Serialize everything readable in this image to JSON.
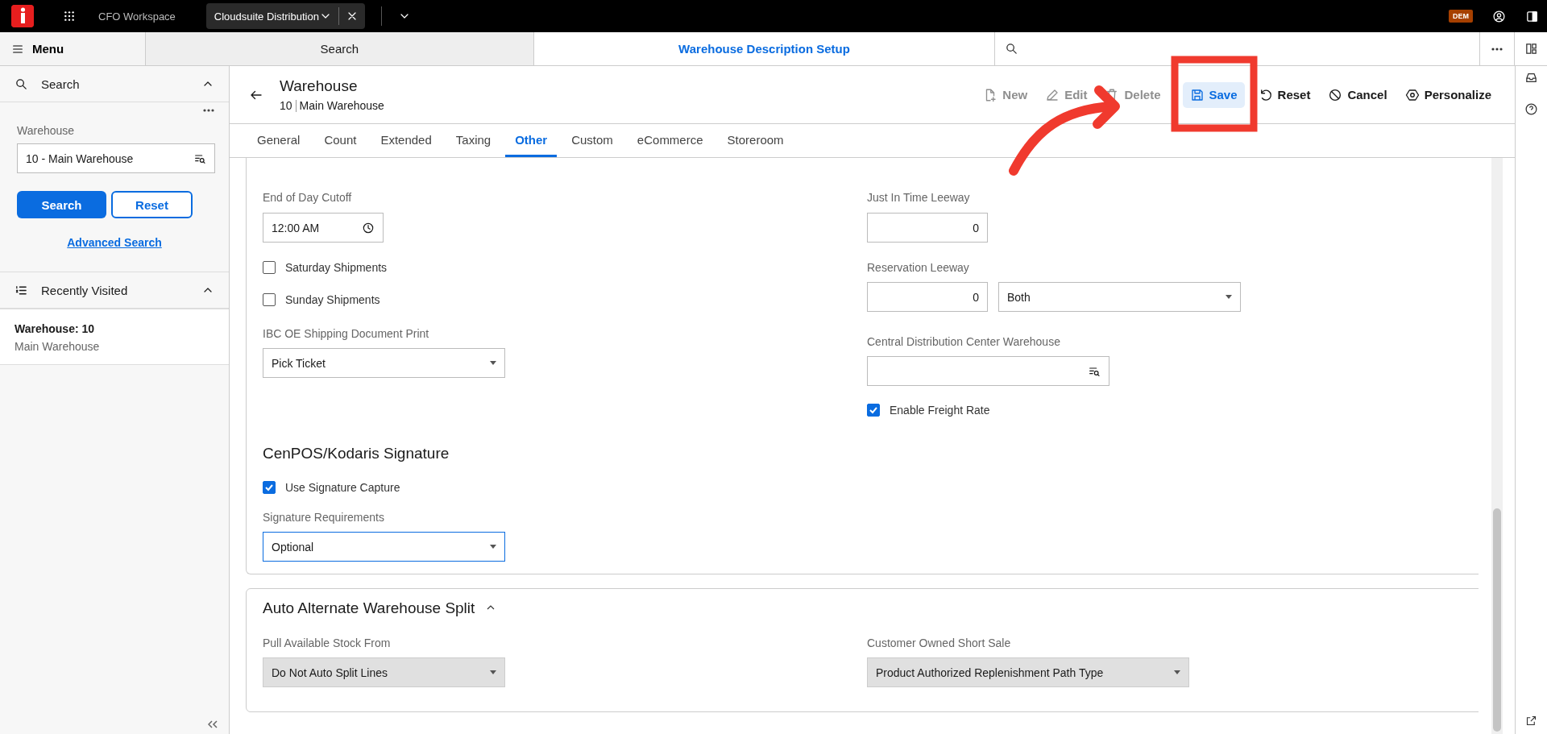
{
  "app_bar": {
    "workspace": "CFO Workspace",
    "tab": "Cloudsuite Distribution",
    "badge": "DEM"
  },
  "nav": {
    "menu": "Menu",
    "tabs": [
      {
        "label": "Search",
        "selected": false
      },
      {
        "label": "Warehouse Description Setup",
        "selected": true
      }
    ]
  },
  "sidebar": {
    "search_title": "Search",
    "field_label": "Warehouse",
    "field_value": "10 - Main Warehouse",
    "search_button": "Search",
    "reset_button": "Reset",
    "advanced_link": "Advanced Search",
    "recent_title": "Recently Visited",
    "recent_items": [
      {
        "title": "Warehouse: 10",
        "subtitle": "Main Warehouse"
      }
    ]
  },
  "header": {
    "title": "Warehouse",
    "id": "10",
    "name": "Main Warehouse"
  },
  "toolbar": [
    {
      "kind": "new",
      "label": "New",
      "disabled": true,
      "selected": false
    },
    {
      "kind": "edit",
      "label": "Edit",
      "disabled": true,
      "selected": false
    },
    {
      "kind": "delete",
      "label": "Delete",
      "disabled": true,
      "selected": false
    },
    {
      "kind": "save",
      "label": "Save",
      "disabled": false,
      "selected": true
    },
    {
      "kind": "reset",
      "label": "Reset",
      "disabled": false,
      "selected": false
    },
    {
      "kind": "cancel",
      "label": "Cancel",
      "disabled": false,
      "selected": false
    },
    {
      "kind": "personalize",
      "label": "Personalize",
      "disabled": false,
      "selected": false
    }
  ],
  "tabs": [
    {
      "label": "General",
      "selected": false
    },
    {
      "label": "Count",
      "selected": false
    },
    {
      "label": "Extended",
      "selected": false
    },
    {
      "label": "Taxing",
      "selected": false
    },
    {
      "label": "Other",
      "selected": true
    },
    {
      "label": "Custom",
      "selected": false
    },
    {
      "label": "eCommerce",
      "selected": false
    },
    {
      "label": "Storeroom",
      "selected": false
    }
  ],
  "shipping": {
    "end_of_day_cutoff": {
      "label": "End of Day Cutoff",
      "value": "12:00 AM"
    },
    "checkboxes": [
      {
        "label": "Saturday Shipments",
        "checked": false
      },
      {
        "label": "Sunday Shipments",
        "checked": false
      }
    ],
    "document_print": {
      "label": "IBC OE Shipping Document Print",
      "value": "Pick Ticket"
    },
    "just_in_time_leeway": {
      "label": "Just In Time Leeway",
      "value": "0"
    },
    "reservation_leeway": {
      "label": "Reservation Leeway",
      "value": "0",
      "unit": "Both"
    },
    "central_distribution": {
      "label": "Central Distribution Center Warehouse"
    },
    "freight_rate": {
      "label": "Enable Freight Rate",
      "checked": true
    }
  },
  "signature": {
    "title": "CenPOS/Kodaris Signature",
    "capture": {
      "label": "Use Signature Capture",
      "checked": true
    },
    "requirements": {
      "label": "Signature Requirements",
      "value": "Optional",
      "focused": true
    }
  },
  "split": {
    "title": "Auto Alternate Warehouse Split",
    "expanded": true,
    "pull": {
      "label": "Pull Available Stock From",
      "value": "Do Not Auto Split Lines",
      "disabled": true
    },
    "short_sale": {
      "label": "Customer Owned Short Sale",
      "value": "Product Authorized Replenishment Path Type",
      "disabled": true
    }
  }
}
